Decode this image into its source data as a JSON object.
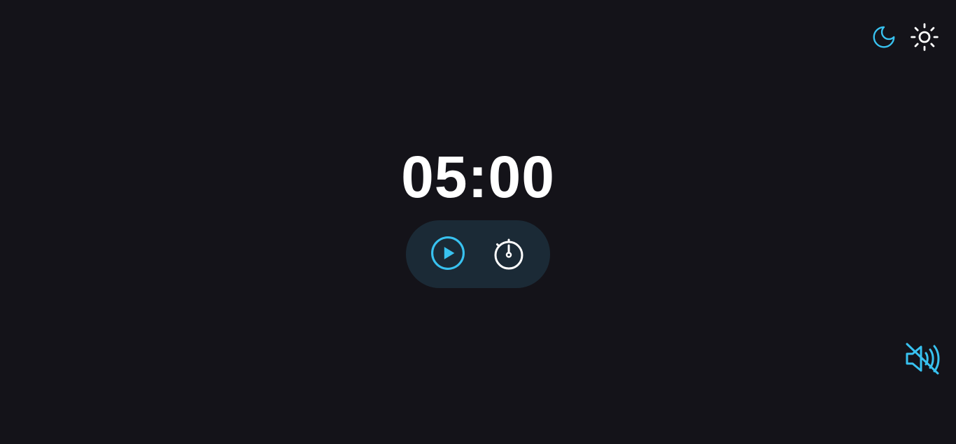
{
  "theme": {
    "dark_icon": "moon-icon",
    "light_icon": "sun-icon",
    "active": "dark"
  },
  "timer": {
    "display": "05:00"
  },
  "controls": {
    "play_icon": "play-icon",
    "mode_icon": "stopwatch-icon"
  },
  "sound": {
    "icon": "speaker-muted-icon",
    "muted": true
  },
  "colors": {
    "background": "#141319",
    "accent": "#38c2f0",
    "text": "#ffffff",
    "controls_background": "#1b2a36"
  }
}
